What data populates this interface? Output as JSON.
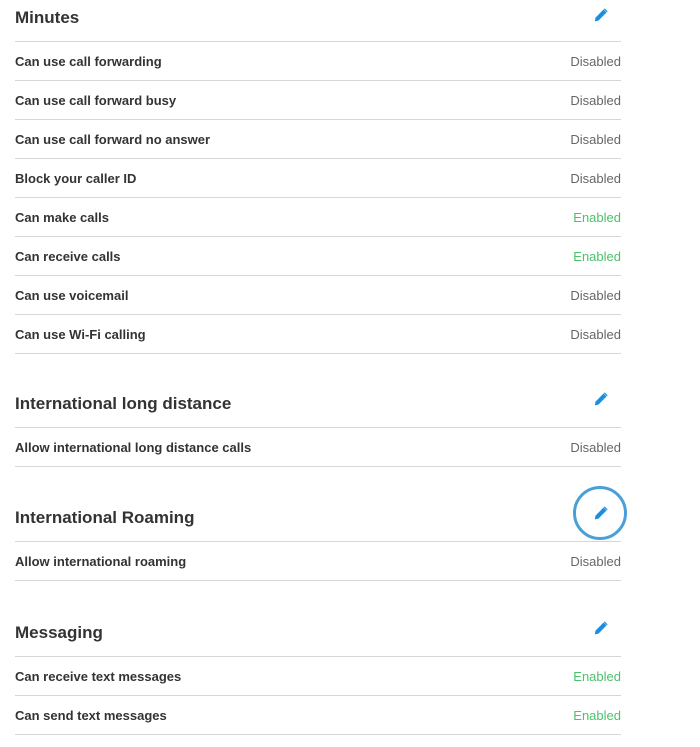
{
  "colors": {
    "accent": "#1a8fe0",
    "enabled": "#4cc26b",
    "disabled": "#666666",
    "highlight_ring": "#4a9fd9"
  },
  "sections": [
    {
      "title": "Minutes",
      "edit_icon": "pencil-icon",
      "rows": [
        {
          "label": "Can use call forwarding",
          "value": "Disabled"
        },
        {
          "label": "Can use call forward busy",
          "value": "Disabled"
        },
        {
          "label": "Can use call forward no answer",
          "value": "Disabled"
        },
        {
          "label": "Block your caller ID",
          "value": "Disabled"
        },
        {
          "label": "Can make calls",
          "value": "Enabled"
        },
        {
          "label": "Can receive calls",
          "value": "Enabled"
        },
        {
          "label": "Can use voicemail",
          "value": "Disabled"
        },
        {
          "label": "Can use Wi-Fi calling",
          "value": "Disabled"
        }
      ]
    },
    {
      "title": "International long distance",
      "edit_icon": "pencil-icon",
      "rows": [
        {
          "label": "Allow international long distance calls",
          "value": "Disabled"
        }
      ]
    },
    {
      "title": "International Roaming",
      "edit_icon": "pencil-icon",
      "rows": [
        {
          "label": "Allow international roaming",
          "value": "Disabled"
        }
      ]
    },
    {
      "title": "Messaging",
      "edit_icon": "pencil-icon",
      "rows": [
        {
          "label": "Can receive text messages",
          "value": "Enabled"
        },
        {
          "label": "Can send text messages",
          "value": "Enabled"
        }
      ]
    }
  ]
}
